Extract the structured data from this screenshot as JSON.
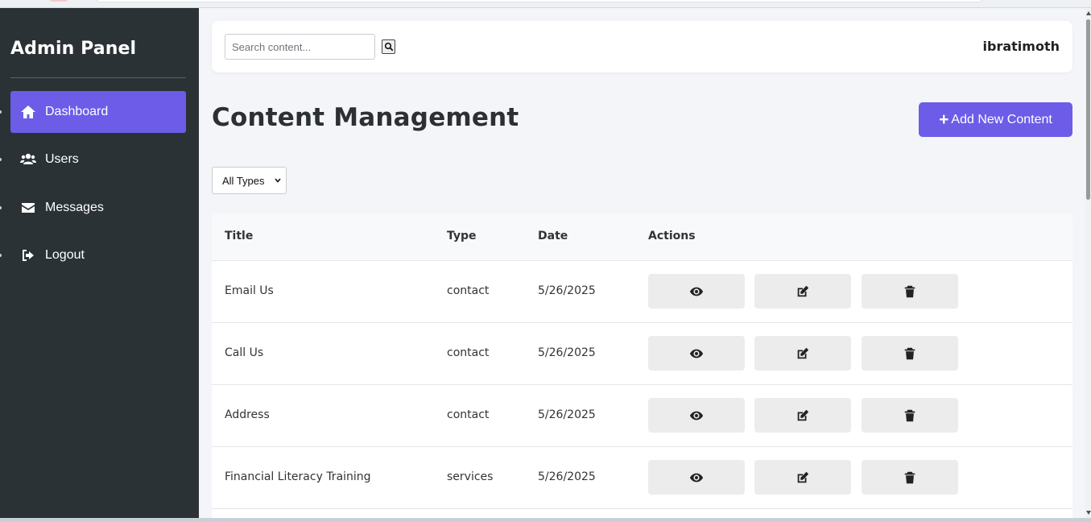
{
  "sidebar": {
    "brand": "Admin Panel",
    "items": [
      {
        "label": "Dashboard",
        "icon": "home-icon",
        "active": true
      },
      {
        "label": "Users",
        "icon": "users-icon",
        "active": false
      },
      {
        "label": "Messages",
        "icon": "envelope-icon",
        "active": false
      },
      {
        "label": "Logout",
        "icon": "sign-out-icon",
        "active": false
      }
    ]
  },
  "header": {
    "search_placeholder": "Search content...",
    "username": "ibratimoth"
  },
  "main": {
    "title": "Content Management",
    "add_button_label": "Add New Content",
    "filter_selected": "All Types"
  },
  "table": {
    "columns": [
      "Title",
      "Type",
      "Date",
      "Actions"
    ],
    "rows": [
      {
        "title": "Email Us",
        "type": "contact",
        "date": "5/26/2025"
      },
      {
        "title": "Call Us",
        "type": "contact",
        "date": "5/26/2025"
      },
      {
        "title": "Address",
        "type": "contact",
        "date": "5/26/2025"
      },
      {
        "title": "Financial Literacy Training",
        "type": "services",
        "date": "5/26/2025"
      }
    ],
    "action_icons": [
      "eye-icon",
      "edit-icon",
      "trash-icon"
    ]
  },
  "colors": {
    "accent": "#6c5ce7",
    "sidebar_bg": "#2b3235",
    "page_bg": "#f4f5f8"
  }
}
